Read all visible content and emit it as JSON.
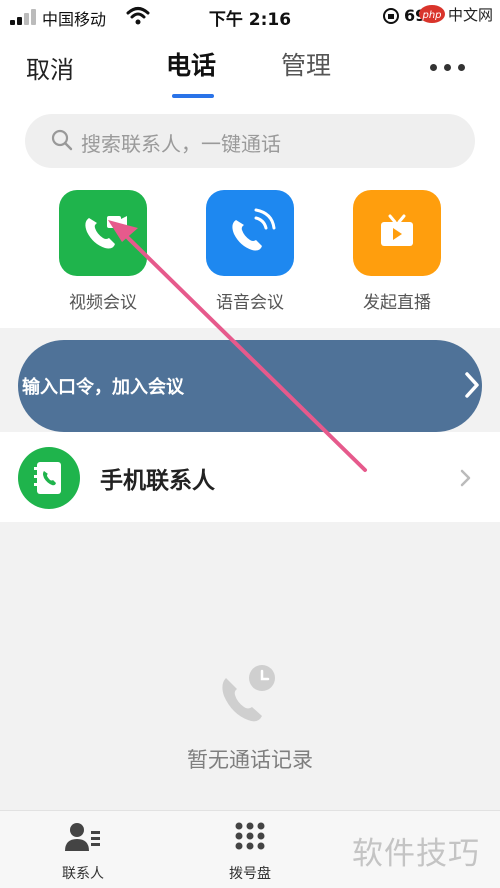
{
  "status": {
    "carrier": "中国移动",
    "time": "下午 2:16",
    "battery": "69%"
  },
  "nav": {
    "cancel_label": "取消",
    "tabs": [
      {
        "label": "电话",
        "active": true
      },
      {
        "label": "管理",
        "active": false
      }
    ],
    "more_icon": "more-dots-icon"
  },
  "search": {
    "placeholder": "搜索联系人，一键通话"
  },
  "actions": [
    {
      "label": "视频会议",
      "icon": "video-call-icon",
      "color": "#1fb44c"
    },
    {
      "label": "语音会议",
      "icon": "voice-call-icon",
      "color": "#1e88f0"
    },
    {
      "label": "发起直播",
      "icon": "live-tv-icon",
      "color": "#ff9e0d"
    }
  ],
  "join_banner": {
    "label": "输入口令，加入会议",
    "color": "#4f7298"
  },
  "contacts_row": {
    "label": "手机联系人",
    "icon": "phonebook-icon"
  },
  "empty_state": {
    "message": "暂无通话记录",
    "icon": "call-history-icon"
  },
  "tabbar": [
    {
      "label": "联系人",
      "icon": "contacts-icon"
    },
    {
      "label": "拨号盘",
      "icon": "dialpad-icon"
    }
  ],
  "watermark": {
    "top": "php中文网",
    "bottom": "软件技巧"
  },
  "colors": {
    "accent": "#2a73e8",
    "annotation_arrow": "#e65a8c"
  }
}
